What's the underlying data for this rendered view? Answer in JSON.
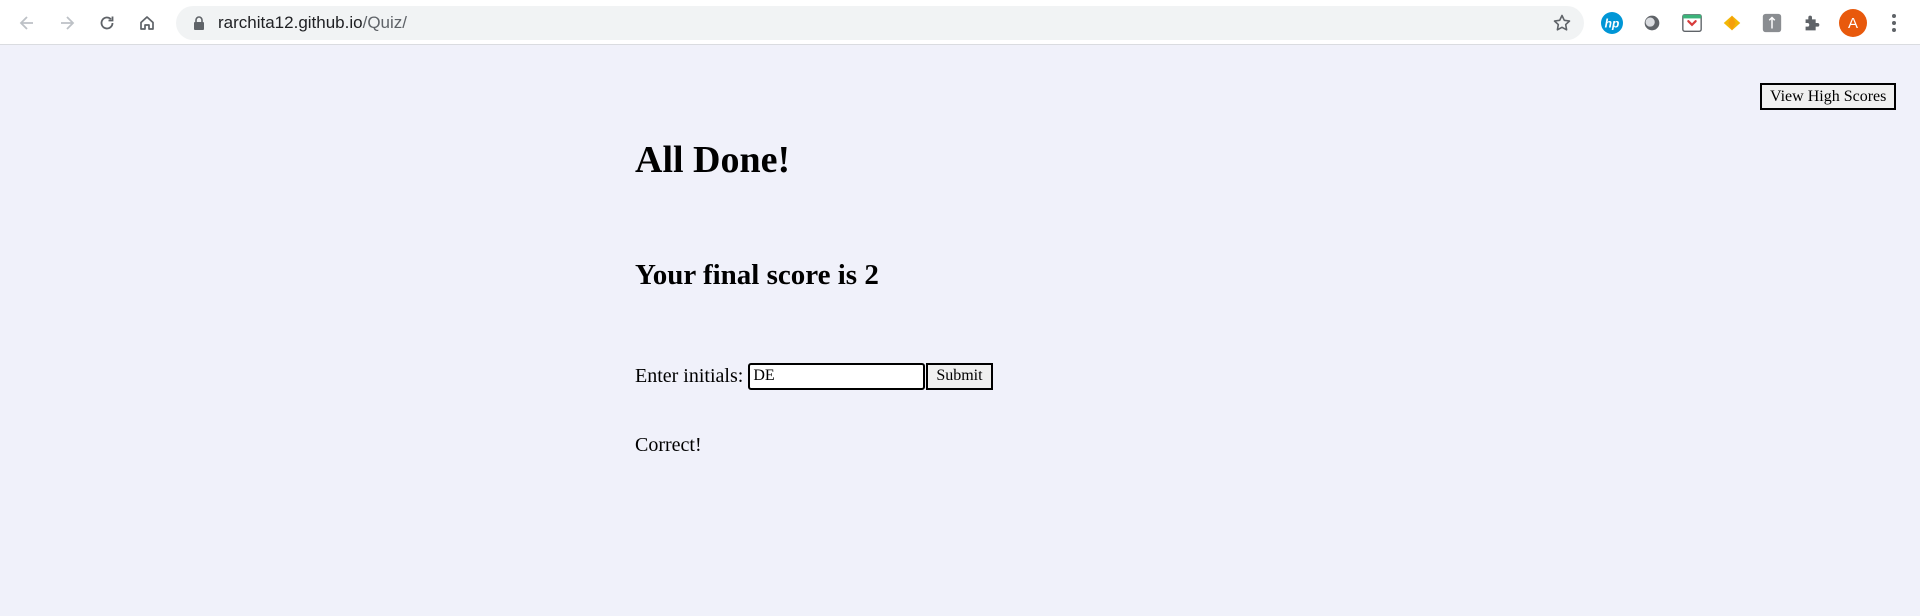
{
  "browser": {
    "url_host": "rarchita12.github.io",
    "url_path": "/Quiz/",
    "profile_initial": "A",
    "accent_colors": {
      "avatar": "#e8590c",
      "hp": "#0096d6"
    },
    "extensions": [
      "hp-icon",
      "circle-extension-icon",
      "pocket-extension-icon",
      "diamond-extension-icon",
      "tile-extension-icon",
      "puzzle-icon"
    ]
  },
  "page": {
    "view_high_scores_label": "View High Scores",
    "title": "All Done!",
    "final_score_label": "Your final score is",
    "final_score_value": "2",
    "initials_label": "Enter initials:",
    "initials_value": "DE",
    "submit_label": "Submit",
    "feedback": "Correct!",
    "background_color": "#f0f1fa"
  }
}
